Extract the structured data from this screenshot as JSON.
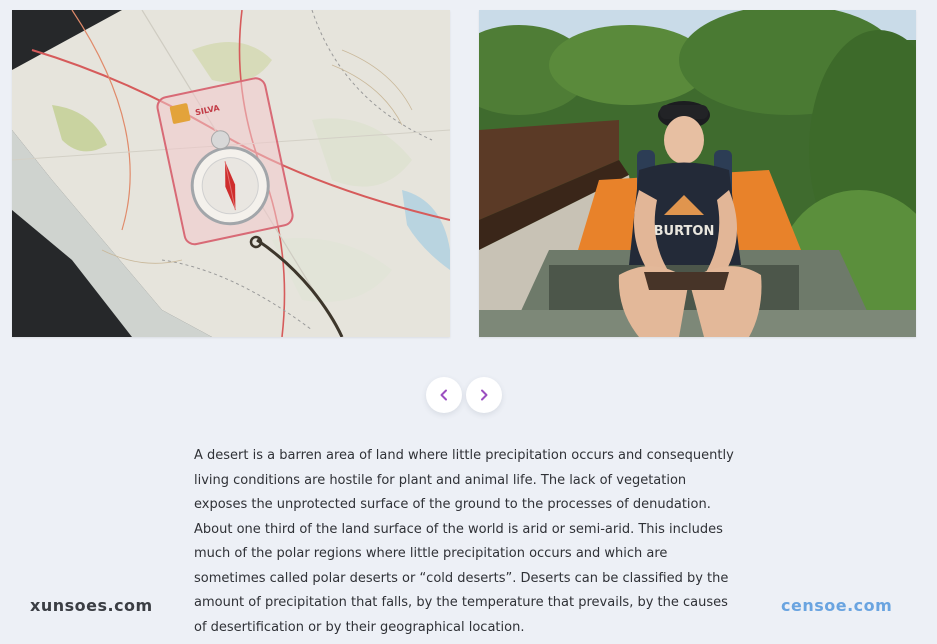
{
  "gallery": {
    "images": [
      {
        "alt": "map-with-compass"
      },
      {
        "alt": "man-sitting-on-train"
      }
    ],
    "shirt_print": "BURTON",
    "compass_brand": "SILVA"
  },
  "carousel": {
    "prev_icon": "chevron-left-icon",
    "next_icon": "chevron-right-icon",
    "accent_color": "#9b4fc0"
  },
  "article": {
    "text": "A desert is a barren area of land where little precipitation occurs and consequently living conditions are hostile for plant and animal life. The lack of vegetation exposes the unprotected surface of the ground to the processes of denudation. About one third of the land surface of the world is arid or semi-arid. This includes much of the polar regions where little precipitation occurs and which are sometimes called polar deserts or “cold deserts”. Deserts can be classified by the amount of precipitation that falls, by the temperature that prevails, by the causes of desertification or by their geographical location."
  },
  "watermarks": {
    "left": "xunsoes.com",
    "right": "censoe.com"
  }
}
